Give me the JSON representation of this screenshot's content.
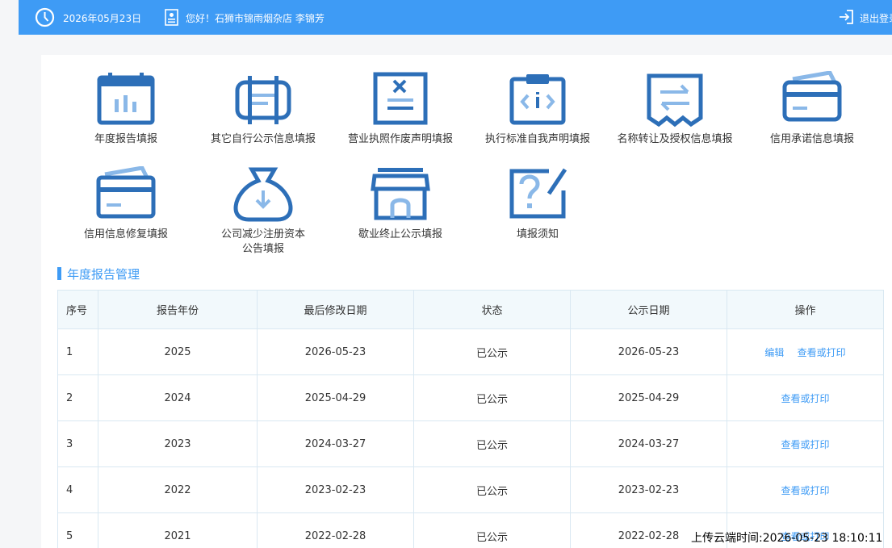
{
  "topbar": {
    "date": "2026年05月23日",
    "greeting": "您好！石狮市锦雨烟杂店 李锦芳",
    "logout_label": "退出登录"
  },
  "tiles": [
    {
      "label": "年度报告填报",
      "icon": "calendar-icon"
    },
    {
      "label": "其它自行公示信息填报",
      "icon": "document-icon"
    },
    {
      "label": "营业执照作废声明填报",
      "icon": "cancelled-license-icon"
    },
    {
      "label": "执行标准自我声明填报",
      "icon": "clipboard-code-icon"
    },
    {
      "label": "名称转让及授权信息填报",
      "icon": "transfer-icon"
    },
    {
      "label": "信用承诺信息填报",
      "icon": "card-icon"
    },
    {
      "label": "信用信息修复填报",
      "icon": "card-repair-icon"
    },
    {
      "label": "公司减少注册资本",
      "label2": "公告填报",
      "icon": "money-bag-icon"
    },
    {
      "label": "歇业终止公示填报",
      "icon": "store-icon"
    },
    {
      "label": "填报须知",
      "icon": "notice-icon"
    }
  ],
  "section_title": "年度报告管理",
  "table": {
    "headers": [
      "序号",
      "报告年份",
      "最后修改日期",
      "状态",
      "公示日期",
      "操作"
    ],
    "rows": [
      {
        "no": "1",
        "year": "2025",
        "modified": "2026-05-23",
        "status": "已公示",
        "published": "2026-05-23",
        "actions": [
          "编辑",
          "查看或打印"
        ]
      },
      {
        "no": "2",
        "year": "2024",
        "modified": "2025-04-29",
        "status": "已公示",
        "published": "2025-04-29",
        "actions": [
          "查看或打印"
        ]
      },
      {
        "no": "3",
        "year": "2023",
        "modified": "2024-03-27",
        "status": "已公示",
        "published": "2024-03-27",
        "actions": [
          "查看或打印"
        ]
      },
      {
        "no": "4",
        "year": "2022",
        "modified": "2023-02-23",
        "status": "已公示",
        "published": "2023-02-23",
        "actions": [
          "查看或打印"
        ]
      },
      {
        "no": "5",
        "year": "2021",
        "modified": "2022-02-28",
        "status": "已公示",
        "published": "2022-02-28",
        "actions": [
          "查看或打印"
        ]
      }
    ]
  },
  "upload_time": "上传云端时间:2026-05-23 18:10:11",
  "colors": {
    "accent": "#3e9bf5",
    "icon_dark": "#2d6fb8",
    "icon_light": "#8ab8e8"
  }
}
